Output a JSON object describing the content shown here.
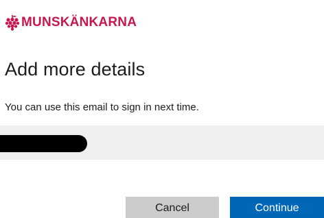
{
  "brand": {
    "name": "MUNSKÄNKARNA",
    "logo_icon": "grape-cluster-icon",
    "color": "#c8174f"
  },
  "form": {
    "title": "Add more details",
    "description": "You can use this email to sign in next time.",
    "email_value": "",
    "email_redacted": true
  },
  "actions": {
    "cancel_label": "Cancel",
    "continue_label": "Continue"
  },
  "colors": {
    "primary_button": "#0067b8",
    "secondary_button": "#cccccc",
    "field_background": "#efefef"
  }
}
